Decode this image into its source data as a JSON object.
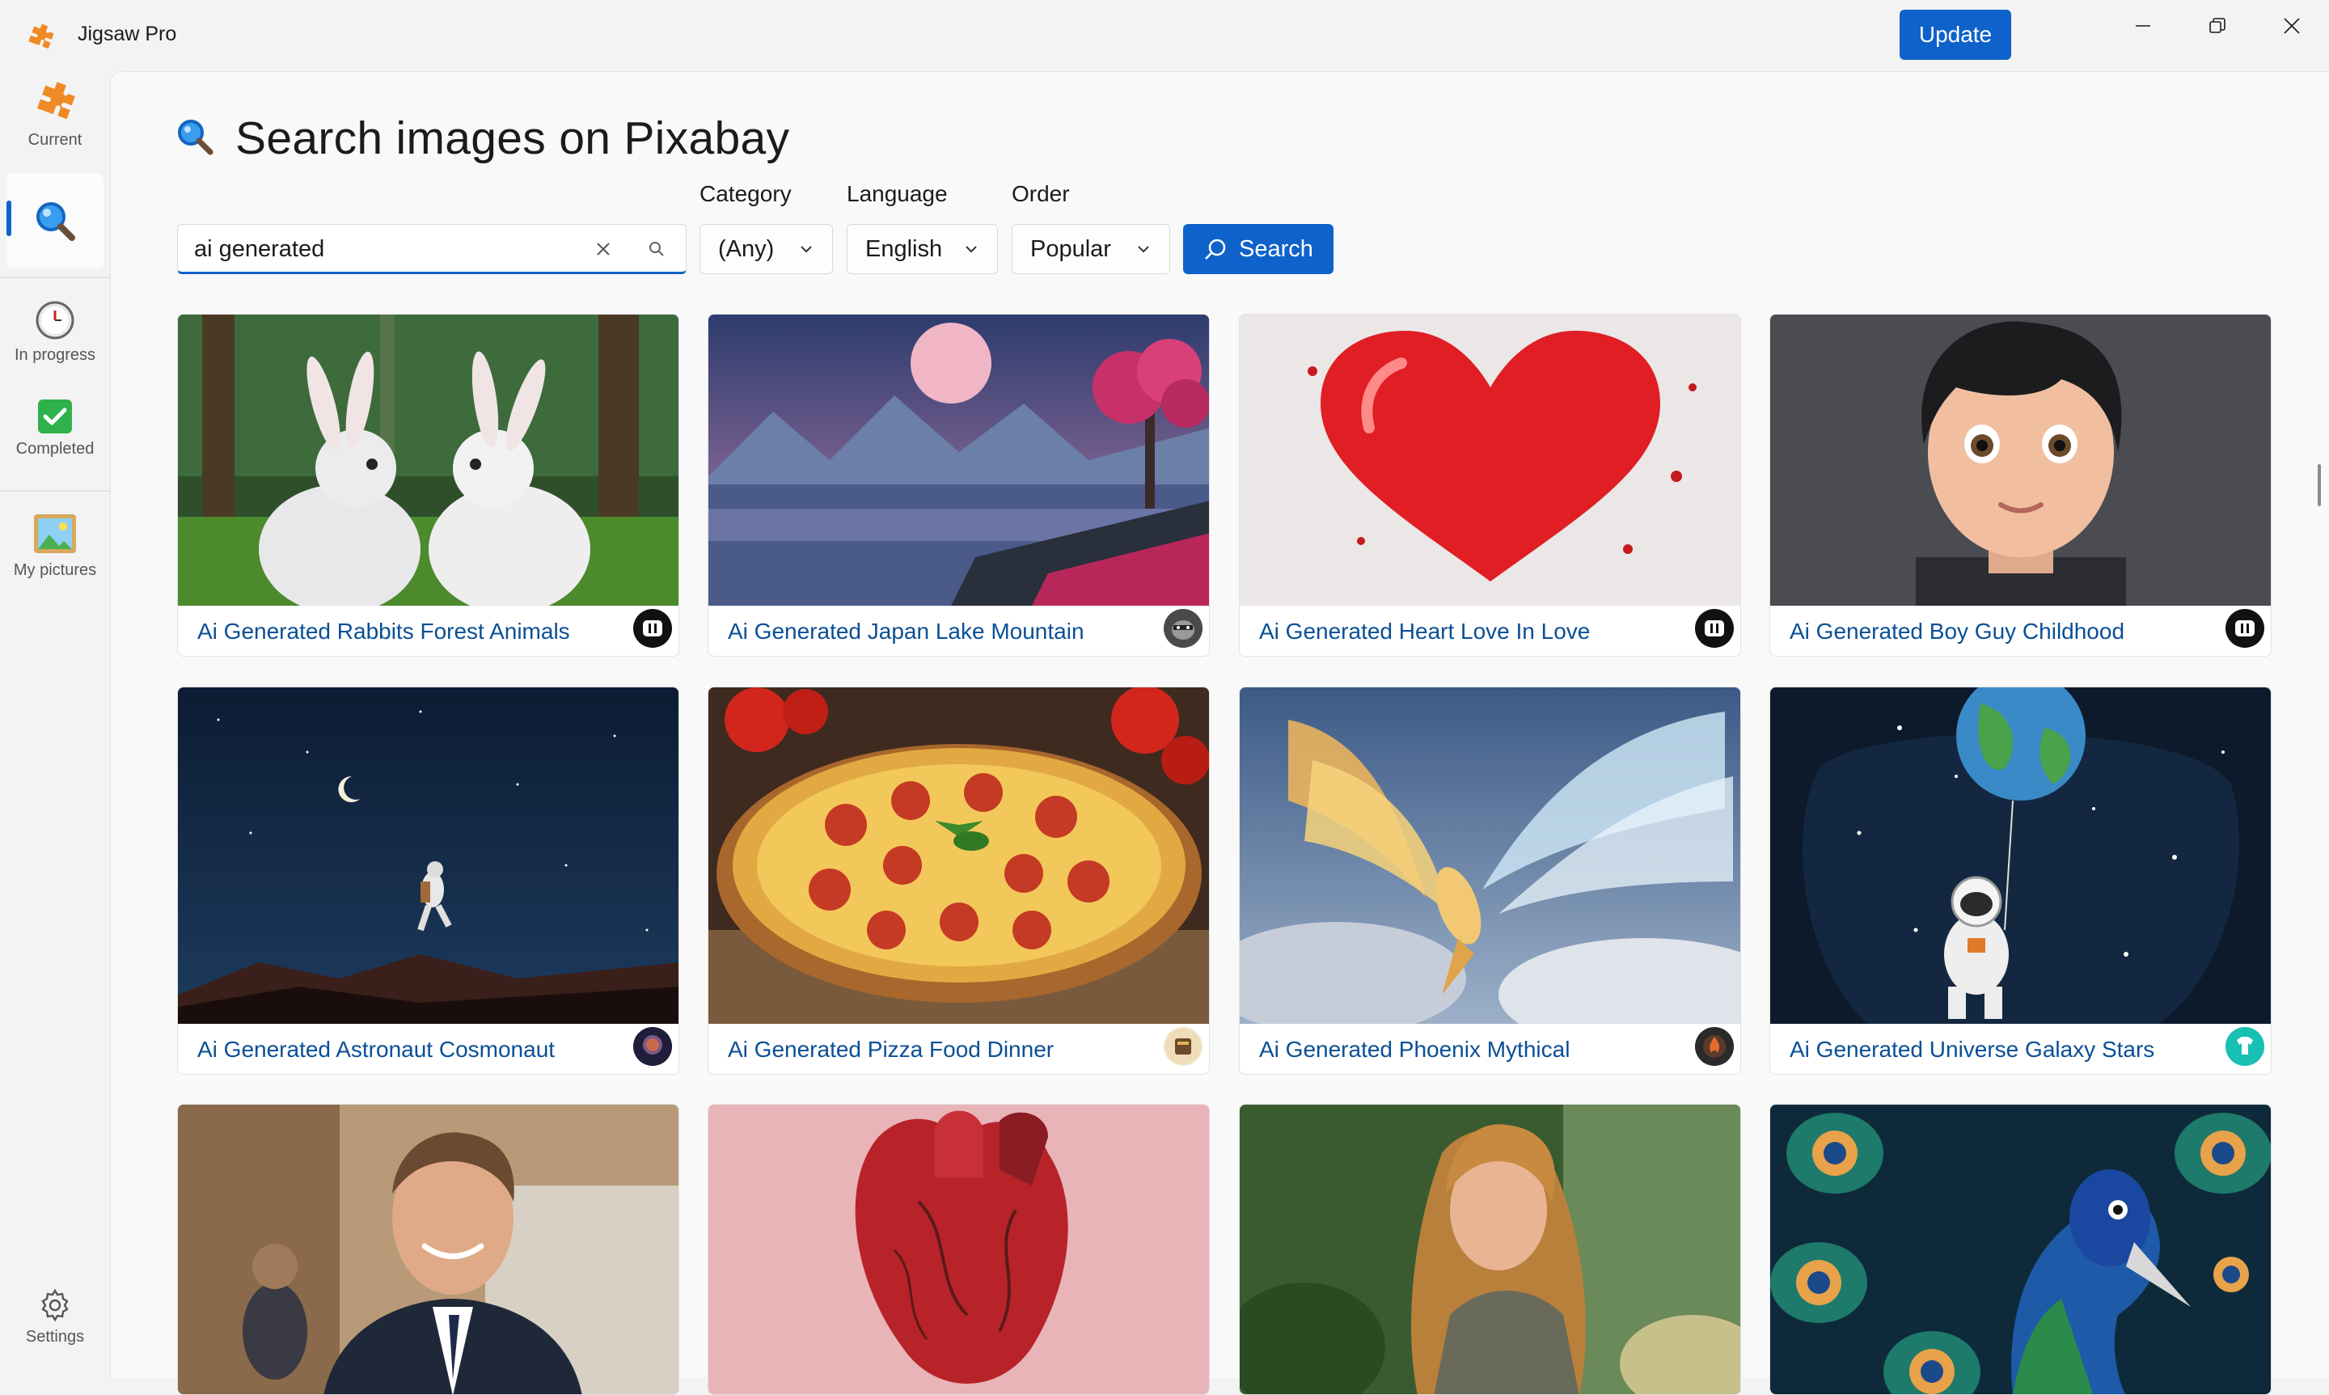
{
  "window": {
    "title": "Jigsaw Pro",
    "update_label": "Update",
    "accent": "#0f62c9"
  },
  "sidebar": {
    "items": [
      {
        "label": "Current",
        "icon": "puzzle-piece-icon"
      },
      {
        "label": "",
        "icon": "search-icon",
        "selected": true
      },
      {
        "label": "In progress",
        "icon": "clock-icon"
      },
      {
        "label": "Completed",
        "icon": "checkmark-icon"
      },
      {
        "label": "My pictures",
        "icon": "picture-icon"
      },
      {
        "label": "Settings",
        "icon": "gear-icon"
      }
    ]
  },
  "page": {
    "title": "Search images on Pixabay",
    "icon": "magnifier-icon"
  },
  "search": {
    "value": "ai generated"
  },
  "filters": {
    "category_label": "Category",
    "category_value": "(Any)",
    "language_label": "Language",
    "language_value": "English",
    "order_label": "Order",
    "order_value": "Popular",
    "search_button": "Search"
  },
  "results": [
    {
      "title": "Ai Generated Rabbits Forest Animals",
      "image": "rabbits-forest"
    },
    {
      "title": "Ai Generated Japan Lake Mountain",
      "image": "japan-lake"
    },
    {
      "title": "Ai Generated Heart Love In Love",
      "image": "red-heart"
    },
    {
      "title": "Ai Generated Boy Guy Childhood",
      "image": "cartoon-boy"
    },
    {
      "title": "Ai Generated Astronaut Cosmonaut",
      "image": "astronaut-night"
    },
    {
      "title": "Ai Generated Pizza Food Dinner",
      "image": "pizza"
    },
    {
      "title": "Ai Generated Phoenix Mythical",
      "image": "phoenix"
    },
    {
      "title": "Ai Generated Universe Galaxy Stars",
      "image": "astronaut-balloon"
    },
    {
      "title": "",
      "image": "businessman"
    },
    {
      "title": "",
      "image": "anatomical-heart"
    },
    {
      "title": "",
      "image": "woman-jungle"
    },
    {
      "title": "",
      "image": "peacock"
    }
  ]
}
